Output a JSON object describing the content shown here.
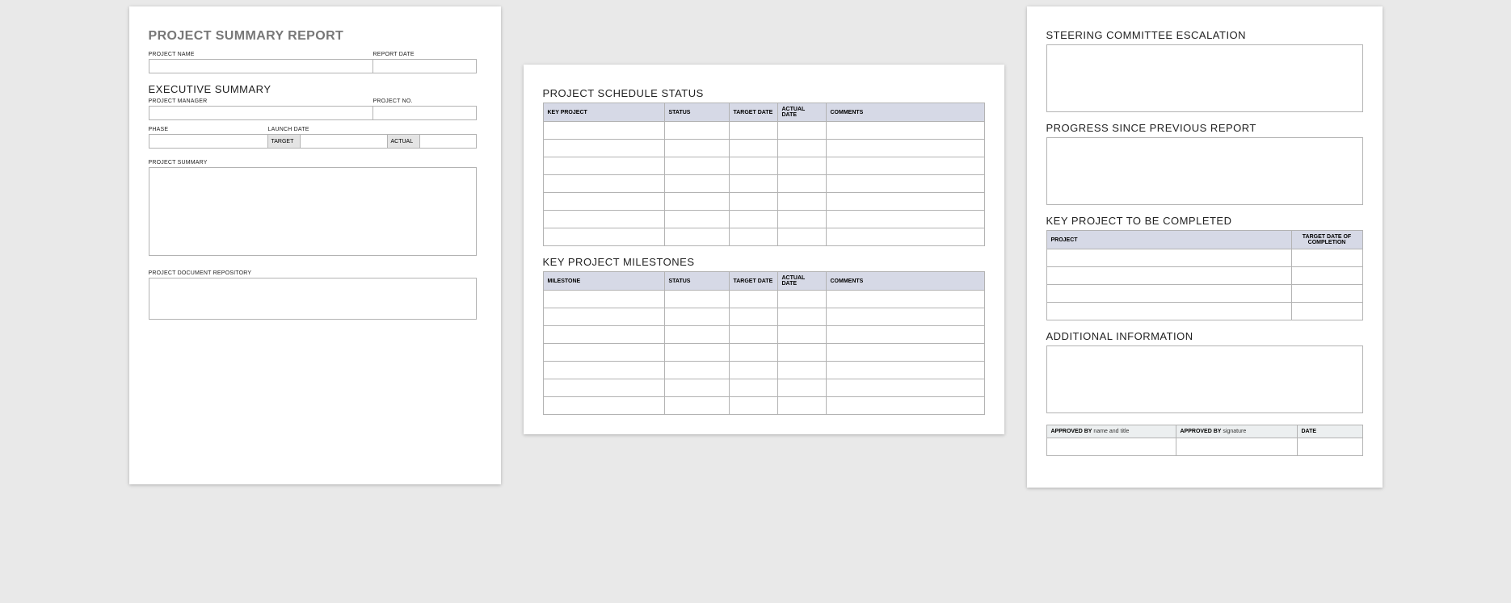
{
  "page1": {
    "title": "PROJECT SUMMARY REPORT",
    "projectNameLabel": "PROJECT NAME",
    "reportDateLabel": "REPORT DATE",
    "execSummary": "EXECUTIVE SUMMARY",
    "projectManagerLabel": "PROJECT MANAGER",
    "projectNoLabel": "PROJECT NO.",
    "phaseLabel": "PHASE",
    "launchDateLabel": "LAUNCH DATE",
    "targetLabel": "TARGET",
    "actualLabel": "ACTUAL",
    "projectSummaryLabel": "PROJECT SUMMARY",
    "docRepoLabel": "PROJECT DOCUMENT REPOSITORY"
  },
  "page2": {
    "scheduleTitle": "PROJECT SCHEDULE STATUS",
    "scheduleHeaders": [
      "KEY PROJECT",
      "STATUS",
      "TARGET DATE",
      "ACTUAL DATE",
      "COMMENTS"
    ],
    "scheduleRows": 7,
    "milestoneTitle": "KEY PROJECT MILESTONES",
    "milestoneHeaders": [
      "MILESTONE",
      "STATUS",
      "TARGET DATE",
      "ACTUAL DATE",
      "COMMENTS"
    ],
    "milestoneRows": 7
  },
  "page3": {
    "steeringTitle": "STEERING COMMITTEE ESCALATION",
    "progressTitle": "PROGRESS SINCE PREVIOUS REPORT",
    "keyProjectTitle": "KEY PROJECT TO BE COMPLETED",
    "keyProjectHeaders": [
      "PROJECT",
      "TARGET DATE OF COMPLETION"
    ],
    "keyProjectRows": 4,
    "additionalTitle": "ADDITIONAL INFORMATION",
    "approvedByName": "APPROVED BY",
    "approvedByNameHint": "name and title",
    "approvedBySig": "APPROVED BY",
    "approvedBySigHint": "signature",
    "dateLabel": "DATE"
  }
}
